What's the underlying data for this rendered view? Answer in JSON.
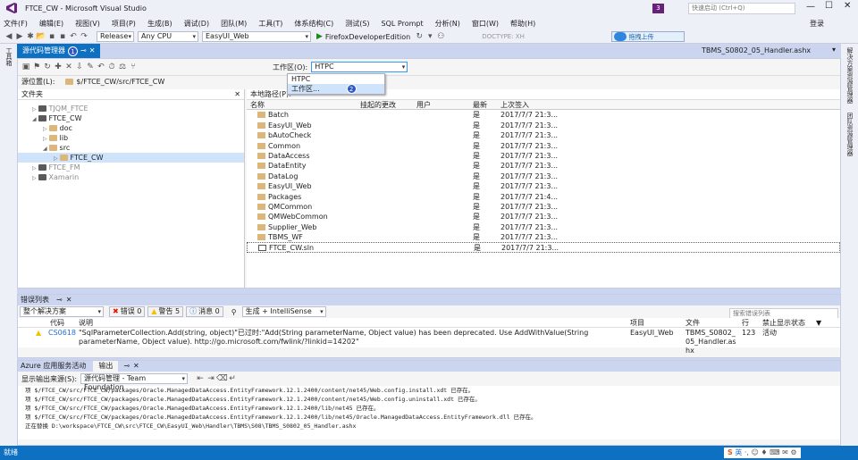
{
  "window": {
    "title": "FTCE_CW - Microsoft Visual Studio",
    "notif_count": "3",
    "quick_launch_placeholder": "快速启动 (Ctrl+Q)",
    "login": "登录"
  },
  "menu": [
    "文件(F)",
    "编辑(E)",
    "视图(V)",
    "项目(P)",
    "生成(B)",
    "调试(D)",
    "团队(M)",
    "工具(T)",
    "体系结构(C)",
    "测试(S)",
    "SQL Prompt",
    "分析(N)",
    "窗口(W)",
    "帮助(H)"
  ],
  "toolbar": {
    "config": "Release",
    "platform": "Any CPU",
    "project": "EasyUI_Web",
    "run_label": "FirefoxDeveloperEdition",
    "doctype": "DOCTYPE: XH",
    "upload_label": "拖拽上传"
  },
  "side": {
    "left_tabs": [
      "工具箱"
    ],
    "right_tabs": [
      "解决方案资源管理器",
      "团队资源管理器"
    ]
  },
  "doc": {
    "active_tab": "源代码管理器",
    "right_file": "TBMS_S0802_05_Handler.ashx"
  },
  "scc": {
    "workspace_label": "工作区(O):",
    "workspace_value": "HTPC",
    "dropdown": [
      "HTPC",
      "工作区..."
    ],
    "source_location_label": "源位置(L):",
    "source_location": "$/FTCE_CW/src/FTCE_CW",
    "folders_header": "文件夹",
    "local_path_label": "本地路径(P):",
    "tree": [
      {
        "label": "TJQM_FTCE",
        "level": 1,
        "greyed": true
      },
      {
        "label": "FTCE_CW",
        "level": 1,
        "greyed": false
      },
      {
        "label": "doc",
        "level": 2,
        "greyed": false
      },
      {
        "label": "lib",
        "level": 2,
        "greyed": false
      },
      {
        "label": "src",
        "level": 2,
        "greyed": false
      },
      {
        "label": "FTCE_CW",
        "level": 3,
        "greyed": false,
        "selected": true
      },
      {
        "label": "FTCE_FM",
        "level": 1,
        "greyed": true
      },
      {
        "label": "Xamarin",
        "level": 1,
        "greyed": true
      }
    ],
    "columns": [
      "名称",
      "挂起的更改",
      "用户",
      "最新",
      "上次签入"
    ],
    "files": [
      {
        "name": "Batch",
        "latest": "是",
        "checkin": "2017/7/7 21:3..."
      },
      {
        "name": "EasyUI_Web",
        "latest": "是",
        "checkin": "2017/7/7 21:3..."
      },
      {
        "name": "bAutoCheck",
        "latest": "是",
        "checkin": "2017/7/7 21:3..."
      },
      {
        "name": "Common",
        "latest": "是",
        "checkin": "2017/7/7 21:3..."
      },
      {
        "name": "DataAccess",
        "latest": "是",
        "checkin": "2017/7/7 21:3..."
      },
      {
        "name": "DataEntity",
        "latest": "是",
        "checkin": "2017/7/7 21:3..."
      },
      {
        "name": "DataLog",
        "latest": "是",
        "checkin": "2017/7/7 21:3..."
      },
      {
        "name": "EasyUI_Web",
        "latest": "是",
        "checkin": "2017/7/7 21:3..."
      },
      {
        "name": "Packages",
        "latest": "是",
        "checkin": "2017/7/7 21:4..."
      },
      {
        "name": "QMCommon",
        "latest": "是",
        "checkin": "2017/7/7 21:3..."
      },
      {
        "name": "QMWebCommon",
        "latest": "是",
        "checkin": "2017/7/7 21:3..."
      },
      {
        "name": "Supplier_Web",
        "latest": "是",
        "checkin": "2017/7/7 21:3..."
      },
      {
        "name": "TBMS_WF",
        "latest": "是",
        "checkin": "2017/7/7 21:3..."
      },
      {
        "name": "FTCE_CW.sln",
        "latest": "是",
        "checkin": "2017/7/7 21:3...",
        "file": true
      }
    ]
  },
  "errorlist": {
    "title": "错误列表",
    "scope": "整个解决方案",
    "errors": "错误 0",
    "warnings": "警告 5",
    "messages": "消息 0",
    "build_filter": "生成 + IntelliSense",
    "search_placeholder": "搜索错误列表",
    "columns": [
      "代码",
      "说明",
      "项目",
      "文件",
      "行",
      "禁止显示状态"
    ],
    "row": {
      "code": "CS0618",
      "desc": "\"SqlParameterCollection.Add(string, object)\"已过时:\"Add(String parameterName, Object value) has been deprecated.  Use AddWithValue(String parameterName, Object value).  http://go.microsoft.com/fwlink/?linkid=14202\"",
      "project": "EasyUI_Web",
      "file": "TBMS_S0802_05_Handler.ashx",
      "line": "123",
      "status": "活动"
    }
  },
  "output": {
    "tabs": [
      "Azure 应用服务活动",
      "输出"
    ],
    "source_label": "显示输出来源(S):",
    "source_value": "源代码管理 - Team Foundation",
    "lines": [
      "项 $/FTCE_CW/src/FTCE_CW/packages/Oracle.ManagedDataAccess.EntityFramework.12.1.2400/content/net45/Web.config.install.xdt 已存在。",
      "项 $/FTCE_CW/src/FTCE_CW/packages/Oracle.ManagedDataAccess.EntityFramework.12.1.2400/content/net45/Web.config.uninstall.xdt 已存在。",
      "项 $/FTCE_CW/src/FTCE_CW/packages/Oracle.ManagedDataAccess.EntityFramework.12.1.2400/lib/net45 已存在。",
      "项 $/FTCE_CW/src/FTCE_CW/packages/Oracle.ManagedDataAccess.EntityFramework.12.1.2400/lib/net45/Oracle.ManagedDataAccess.EntityFramework.dll 已存在。",
      "正在替换 D:\\workspace\\FTCE_CW\\src\\FTCE_CW\\EasyUI_Web\\Handler\\TBMS\\S08\\TBMS_S0802_05_Handler.ashx"
    ]
  },
  "status": {
    "text": "就绪",
    "ime": "英"
  },
  "colors": {
    "accent": "#0e70c0",
    "background": "#ccd5f0",
    "badge": "#2c57c8",
    "warning": "#f2c200",
    "error": "#e51400"
  }
}
